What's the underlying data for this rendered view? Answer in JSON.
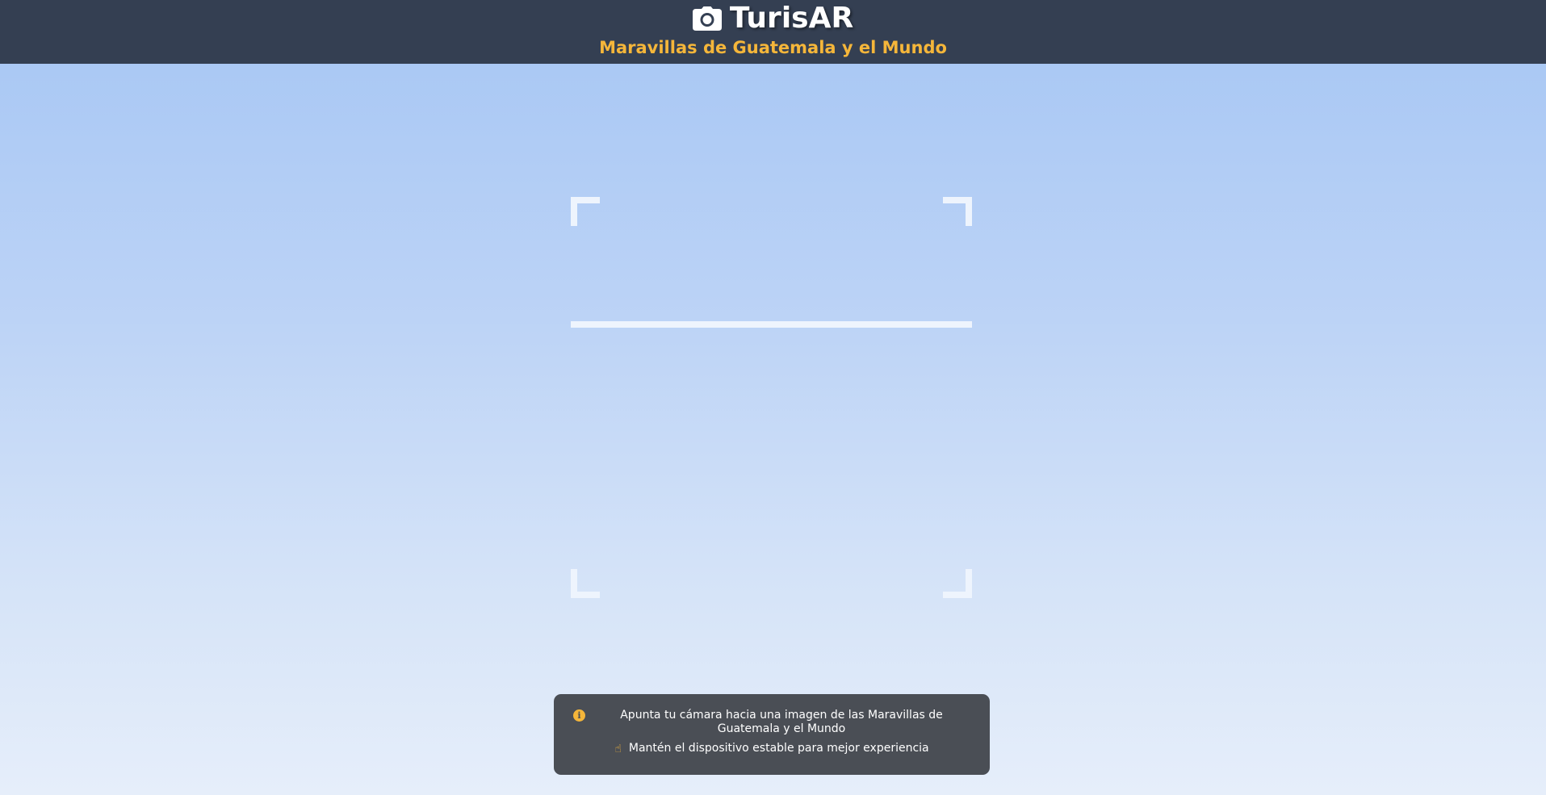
{
  "header": {
    "title": "TurisAR",
    "subtitle": "Maravillas de Guatemala y el Mundo",
    "icon": "camera-icon"
  },
  "scanner": {
    "corners": [
      "top-left",
      "top-right",
      "bottom-left",
      "bottom-right"
    ],
    "frame_color": "#eef4fd"
  },
  "instructions": {
    "line1": "Apunta tu cámara hacia una imagen de las Maravillas de Guatemala y el Mundo",
    "line1_icon": "info-icon",
    "line2": "Mantén el dispositivo estable para mejor experiencia",
    "line2_icon": "pointing-hand-icon"
  },
  "colors": {
    "header_bg": "#343f52",
    "accent": "#f5b63a",
    "info_box_bg": "#4a4e55"
  }
}
